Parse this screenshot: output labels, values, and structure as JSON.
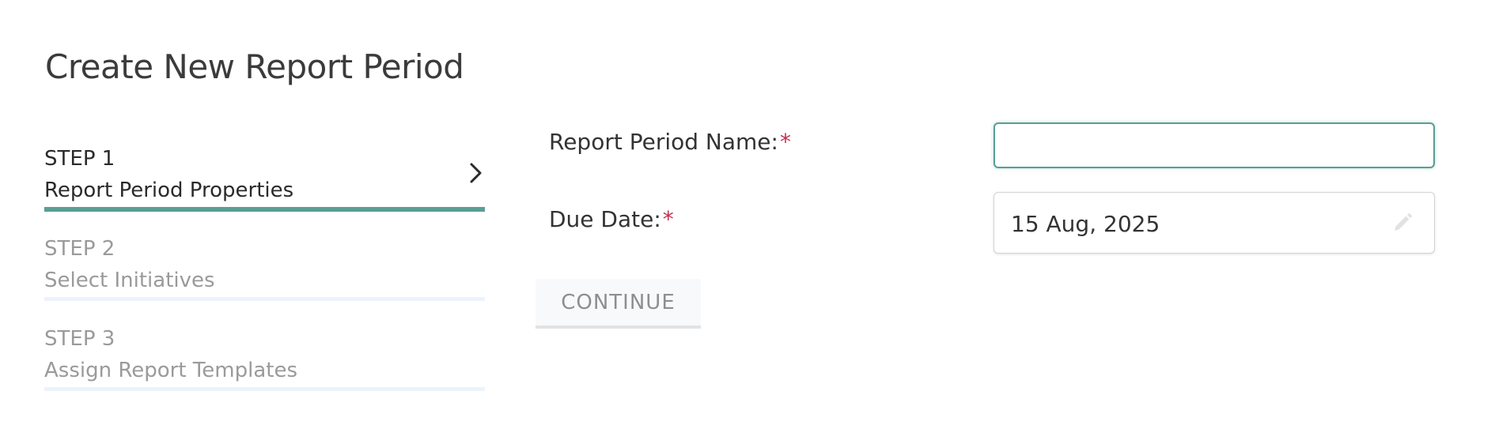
{
  "page": {
    "title": "Create New Report Period"
  },
  "steps": [
    {
      "number": "STEP 1",
      "label": "Report Period Properties",
      "state": "active"
    },
    {
      "number": "STEP 2",
      "label": "Select Initiatives",
      "state": "inactive"
    },
    {
      "number": "STEP 3",
      "label": "Assign Report Templates",
      "state": "inactive"
    }
  ],
  "form": {
    "name_label": "Report Period Name:",
    "name_value": "",
    "due_date_label": "Due Date:",
    "due_date_value": "15 Aug, 2025",
    "required_marker": "*",
    "continue_label": "CONTINUE"
  },
  "colors": {
    "accent": "#5a9e94",
    "required": "#c0334f",
    "inactive_text": "#9a9a9a",
    "inactive_bar": "#edf3fd"
  },
  "icons": {
    "step_chevron": "chevron-right-icon",
    "date_edit": "pencil-icon"
  }
}
